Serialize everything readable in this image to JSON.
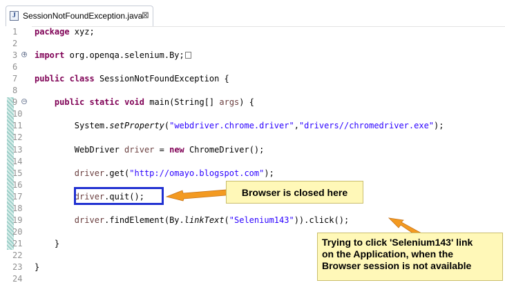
{
  "tab": {
    "icon_letter": "J",
    "title": "SessionNotFoundException.java",
    "close": "⊠"
  },
  "code_lines": [
    {
      "n": "1",
      "segs": [
        {
          "t": "package",
          "c": "kw"
        },
        {
          "t": " xyz;",
          "c": ""
        }
      ]
    },
    {
      "n": "2",
      "segs": []
    },
    {
      "n": "3",
      "fold": "plus",
      "segs": [
        {
          "t": "import",
          "c": "kw"
        },
        {
          "t": " org.openqa.selenium.By;",
          "c": ""
        }
      ],
      "folded": true
    },
    {
      "n": "6",
      "segs": []
    },
    {
      "n": "7",
      "segs": [
        {
          "t": "public",
          "c": "kw"
        },
        {
          "t": " ",
          "c": ""
        },
        {
          "t": "class",
          "c": "kw"
        },
        {
          "t": " SessionNotFoundException {",
          "c": ""
        }
      ]
    },
    {
      "n": "8",
      "segs": []
    },
    {
      "n": "9",
      "fold": "minus",
      "segs": [
        {
          "t": "    ",
          "c": ""
        },
        {
          "t": "public",
          "c": "kw"
        },
        {
          "t": " ",
          "c": ""
        },
        {
          "t": "static",
          "c": "kw"
        },
        {
          "t": " ",
          "c": ""
        },
        {
          "t": "void",
          "c": "kw"
        },
        {
          "t": " main(String[] ",
          "c": ""
        },
        {
          "t": "args",
          "c": "var"
        },
        {
          "t": ") {",
          "c": ""
        }
      ]
    },
    {
      "n": "10",
      "segs": []
    },
    {
      "n": "11",
      "segs": [
        {
          "t": "        System.",
          "c": ""
        },
        {
          "t": "setProperty",
          "c": "it"
        },
        {
          "t": "(",
          "c": ""
        },
        {
          "t": "\"webdriver.chrome.driver\"",
          "c": "str"
        },
        {
          "t": ",",
          "c": ""
        },
        {
          "t": "\"drivers//chromedriver.exe\"",
          "c": "str"
        },
        {
          "t": ");",
          "c": ""
        }
      ]
    },
    {
      "n": "12",
      "segs": []
    },
    {
      "n": "13",
      "segs": [
        {
          "t": "        WebDriver ",
          "c": ""
        },
        {
          "t": "driver",
          "c": "var"
        },
        {
          "t": " = ",
          "c": ""
        },
        {
          "t": "new",
          "c": "kw"
        },
        {
          "t": " ChromeDriver();",
          "c": ""
        }
      ]
    },
    {
      "n": "14",
      "segs": []
    },
    {
      "n": "15",
      "segs": [
        {
          "t": "        ",
          "c": ""
        },
        {
          "t": "driver",
          "c": "var"
        },
        {
          "t": ".get(",
          "c": ""
        },
        {
          "t": "\"http://omayo.blogspot.com\"",
          "c": "str"
        },
        {
          "t": ");",
          "c": ""
        }
      ]
    },
    {
      "n": "16",
      "segs": []
    },
    {
      "n": "17",
      "segs": [
        {
          "t": "        ",
          "c": ""
        },
        {
          "t": "driver",
          "c": "var"
        },
        {
          "t": ".quit();",
          "c": ""
        }
      ]
    },
    {
      "n": "18",
      "segs": []
    },
    {
      "n": "19",
      "segs": [
        {
          "t": "        ",
          "c": ""
        },
        {
          "t": "driver",
          "c": "var"
        },
        {
          "t": ".findElement(By.",
          "c": ""
        },
        {
          "t": "linkText",
          "c": "it"
        },
        {
          "t": "(",
          "c": ""
        },
        {
          "t": "\"Selenium143\"",
          "c": "str"
        },
        {
          "t": ")).click();",
          "c": ""
        }
      ]
    },
    {
      "n": "20",
      "segs": []
    },
    {
      "n": "21",
      "segs": [
        {
          "t": "    }",
          "c": ""
        }
      ]
    },
    {
      "n": "22",
      "segs": []
    },
    {
      "n": "23",
      "segs": [
        {
          "t": "}",
          "c": ""
        }
      ]
    },
    {
      "n": "24",
      "segs": []
    }
  ],
  "annotations": {
    "callout_1": "Browser is closed here",
    "callout_2_line_1": "Trying to click 'Selenium143' link",
    "callout_2_line_2": "on the Application, when the",
    "callout_2_line_3": "Browser session is not available"
  },
  "colors": {
    "keyword": "#7f0055",
    "string": "#2a00ff",
    "variable": "#6a3e3e",
    "highlight_box": "#1f2fd1",
    "callout_bg": "#fff8b8",
    "arrow": "#f39a21"
  }
}
